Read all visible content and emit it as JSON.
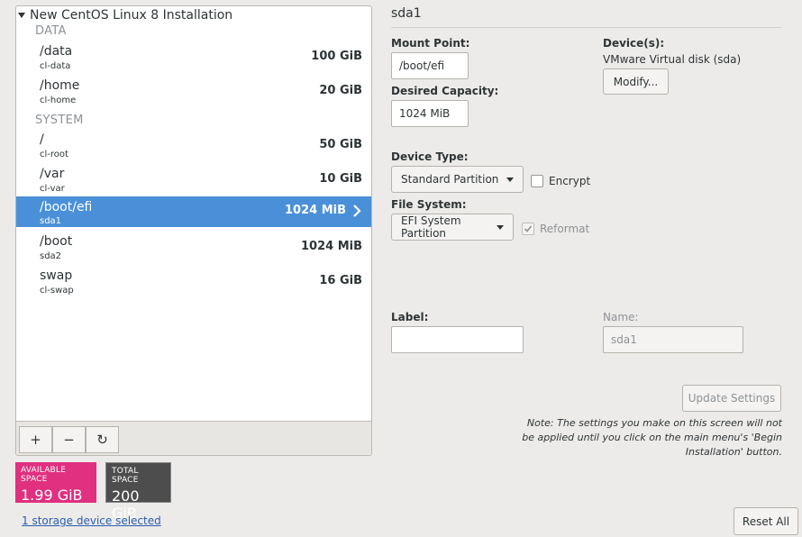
{
  "tree": {
    "title": "New CentOS Linux 8 Installation",
    "groups": [
      {
        "label": "DATA"
      },
      {
        "label": "SYSTEM"
      }
    ],
    "rows": [
      {
        "mount": "/data",
        "device": "cl-data",
        "size": "100 GiB"
      },
      {
        "mount": "/home",
        "device": "cl-home",
        "size": "20 GiB"
      },
      {
        "mount": "/",
        "device": "cl-root",
        "size": "50 GiB"
      },
      {
        "mount": "/var",
        "device": "cl-var",
        "size": "10 GiB"
      },
      {
        "mount": "/boot/efi",
        "device": "sda1",
        "size": "1024 MiB"
      },
      {
        "mount": "/boot",
        "device": "sda2",
        "size": "1024 MiB"
      },
      {
        "mount": "swap",
        "device": "cl-swap",
        "size": "16 GiB"
      }
    ],
    "toolbar": {
      "add": "+",
      "remove": "−",
      "reload": "↻"
    }
  },
  "space": {
    "available_caption": "AVAILABLE SPACE",
    "available_value": "1.99 GiB",
    "total_caption": "TOTAL SPACE",
    "total_value": "200 GiB"
  },
  "storage_link": "1 storage device selected",
  "detail": {
    "header": "sda1",
    "mount_point_label": "Mount Point:",
    "mount_point_value": "/boot/efi",
    "capacity_label": "Desired Capacity:",
    "capacity_value": "1024 MiB",
    "devices_label": "Device(s):",
    "devices_value": "VMware Virtual disk (sda)",
    "modify_button": "Modify...",
    "device_type_label": "Device Type:",
    "device_type_value": "Standard Partition",
    "encrypt_label": "Encrypt",
    "filesystem_label": "File System:",
    "filesystem_value": "EFI System Partition",
    "reformat_label": "Reformat",
    "label_label": "Label:",
    "label_value": "",
    "name_label": "Name:",
    "name_value": "sda1",
    "update_button": "Update Settings",
    "note": "Note:  The settings you make on this screen will not be applied until you click on the main menu's 'Begin Installation' button.",
    "reset_button": "Reset All"
  }
}
